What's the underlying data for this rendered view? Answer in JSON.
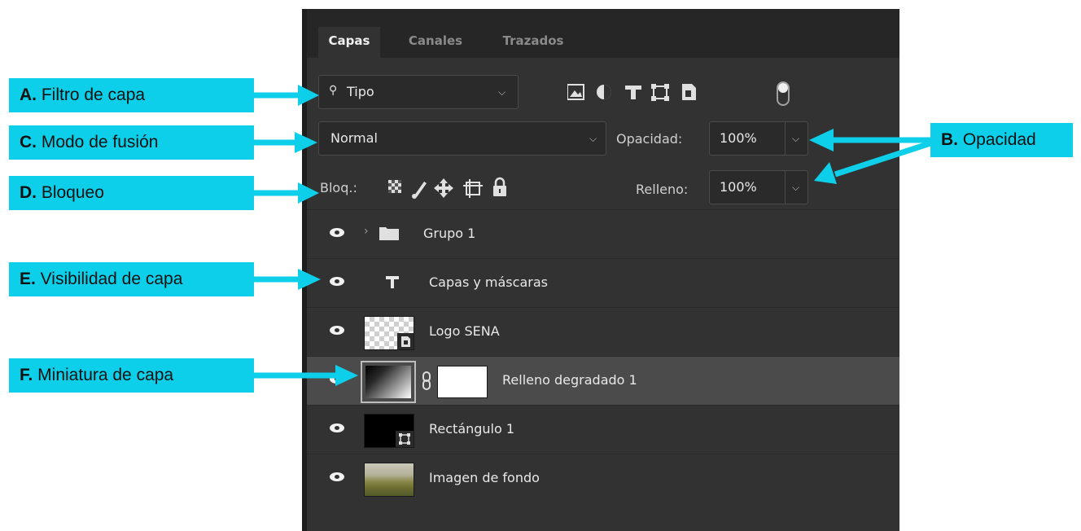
{
  "tabs": [
    "Capas",
    "Canales",
    "Trazados"
  ],
  "filter": {
    "label": "Tipo",
    "icon": "search-icon"
  },
  "filter_icons": [
    "image-filter-icon",
    "adjustment-filter-icon",
    "type-filter-icon",
    "shape-filter-icon",
    "smart-object-filter-icon",
    "filter-toggle-icon"
  ],
  "blend_mode": "Normal",
  "opacity": {
    "label": "Opacidad:",
    "value": "100%"
  },
  "fill": {
    "label": "Relleno:",
    "value": "100%"
  },
  "lock": {
    "label": "Bloq.:",
    "icons": [
      "lock-transparent-pixels-icon",
      "lock-image-pixels-icon",
      "lock-position-icon",
      "lock-artboard-icon",
      "lock-all-icon"
    ]
  },
  "layers": [
    {
      "name": "Grupo 1",
      "type": "group",
      "visible": true
    },
    {
      "name": "Capas y máscaras",
      "type": "text",
      "visible": true
    },
    {
      "name": "Logo SENA",
      "type": "smart-object",
      "visible": true
    },
    {
      "name": "Relleno degradado 1",
      "type": "gradient-fill",
      "visible": true,
      "selected": true
    },
    {
      "name": "Rectángulo 1",
      "type": "shape",
      "visible": true
    },
    {
      "name": "Imagen de fondo",
      "type": "image",
      "visible": true
    }
  ],
  "callouts": {
    "a": {
      "letter": "A.",
      "text": " Filtro de capa"
    },
    "b": {
      "letter": "B.",
      "text": " Opacidad"
    },
    "c": {
      "letter": "C.",
      "text": " Modo de fusión"
    },
    "d": {
      "letter": "D.",
      "text": " Bloqueo"
    },
    "e": {
      "letter": "E.",
      "text": " Visibilidad de capa"
    },
    "f": {
      "letter": "F.",
      "text": " Miniatura de capa"
    }
  },
  "colors": {
    "accent": "#0ecfe9",
    "panel": "#323232",
    "tabbar": "#262626",
    "selected_row": "#4b4b4b"
  }
}
